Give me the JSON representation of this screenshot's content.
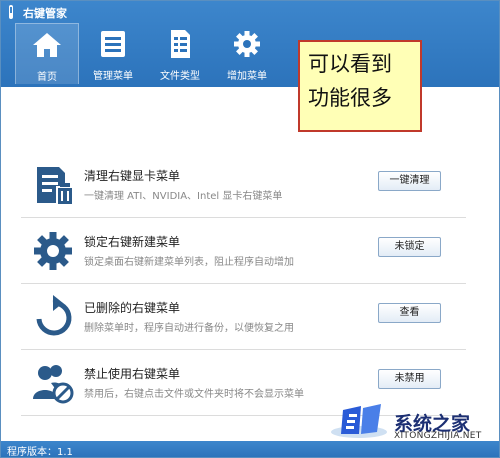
{
  "window": {
    "title": "右键管家"
  },
  "tabs": [
    {
      "label": "首页",
      "icon": "home-icon",
      "active": true
    },
    {
      "label": "管理菜单",
      "icon": "menu-list-icon",
      "active": false
    },
    {
      "label": "文件类型",
      "icon": "file-type-icon",
      "active": false
    },
    {
      "label": "增加菜单",
      "icon": "gear-icon",
      "active": false
    }
  ],
  "callout": {
    "line1": "可以看到",
    "line2": "功能很多"
  },
  "items": [
    {
      "title": "清理右键显卡菜单",
      "desc": "一键清理 ATI、NVIDIA、Intel 显卡右键菜单",
      "button": "一键清理",
      "icon": "clean-document-icon"
    },
    {
      "title": "锁定右键新建菜单",
      "desc": "锁定桌面右键新建菜单列表，阻止程序自动增加",
      "button": "未锁定",
      "icon": "gear-icon"
    },
    {
      "title": "已删除的右键菜单",
      "desc": "删除菜单时，程序自动进行备份，以便恢复之用",
      "button": "查看",
      "icon": "restore-arrow-icon"
    },
    {
      "title": "禁止使用右键菜单",
      "desc": "禁用后，右键点击文件或文件夹时将不会显示菜单",
      "button": "未禁用",
      "icon": "user-block-icon"
    }
  ],
  "status": {
    "version": "程序版本：1.1"
  },
  "watermark": {
    "name": "系统之家",
    "url": "XITONGZHIJIA.NET"
  },
  "colors": {
    "header": "#3d86cc",
    "callout_bg": "#ffffb6",
    "callout_border": "#c0392b",
    "icon": "#2b5a8a"
  }
}
